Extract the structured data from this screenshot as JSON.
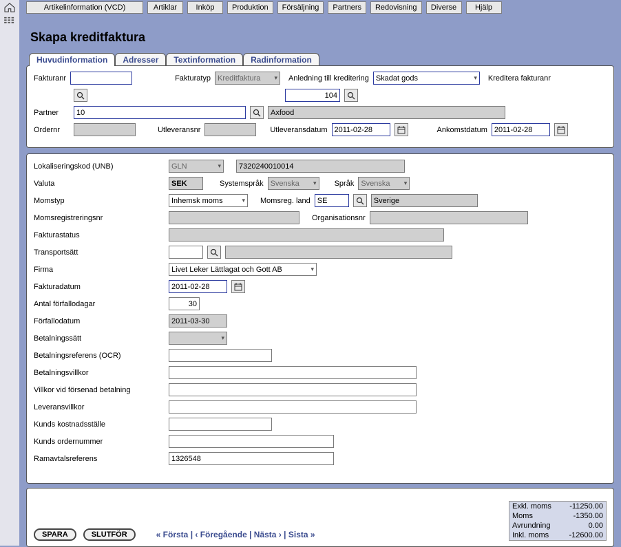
{
  "topmenu": [
    "Artikelinformation (VCD)",
    "Artiklar",
    "Inköp",
    "Produktion",
    "Försäljning",
    "Partners",
    "Redovisning",
    "Diverse",
    "Hjälp"
  ],
  "page_title": "Skapa kreditfaktura",
  "tabs": [
    "Huvudinformation",
    "Adresser",
    "Textinformation",
    "Radinformation"
  ],
  "active_tab": 0,
  "header": {
    "fakturanr_label": "Fakturanr",
    "fakturanr_value": "",
    "fakturatyp_label": "Fakturatyp",
    "fakturatyp_value": "Kreditfaktura",
    "anledning_label": "Anledning till kreditering",
    "anledning_value": "Skadat gods",
    "anledning_code": "104",
    "kreditera_label": "Kreditera fakturanr",
    "partner_label": "Partner",
    "partner_value": "10",
    "partner_name": "Axfood",
    "ordernr_label": "Ordernr",
    "ordernr_value": "",
    "utleveransnr_label": "Utleveransnr",
    "utleveransnr_value": "",
    "utleveransdatum_label": "Utleveransdatum",
    "utleveransdatum_value": "2011-02-28",
    "ankomstdatum_label": "Ankomstdatum",
    "ankomstdatum_value": "2011-02-28"
  },
  "detail": {
    "lokaliseringskod_label": "Lokaliseringskod (UNB)",
    "lokaliseringskod_type": "GLN",
    "lokaliseringskod_value": "7320240010014",
    "valuta_label": "Valuta",
    "valuta_value": "SEK",
    "systemsprak_label": "Systemspråk",
    "systemsprak_value": "Svenska",
    "sprak_label": "Språk",
    "sprak_value": "Svenska",
    "momstyp_label": "Momstyp",
    "momstyp_value": "Inhemsk moms",
    "momsregland_label": "Momsreg. land",
    "momsregland_code": "SE",
    "momsregland_name": "Sverige",
    "momsregnr_label": "Momsregistreringsnr",
    "momsregnr_value": "",
    "orgnr_label": "Organisationsnr",
    "orgnr_value": "",
    "fakturastatus_label": "Fakturastatus",
    "fakturastatus_value": "",
    "transportsatt_label": "Transportsätt",
    "transportsatt_value": "",
    "transportsatt_name": "",
    "firma_label": "Firma",
    "firma_value": "Livet Leker Lättlagat och Gott AB",
    "fakturadatum_label": "Fakturadatum",
    "fakturadatum_value": "2011-02-28",
    "antal_forfallodagar_label": "Antal förfallodagar",
    "antal_forfallodagar_value": "30",
    "forfallodatum_label": "Förfallodatum",
    "forfallodatum_value": "2011-03-30",
    "betalningssatt_label": "Betalningssätt",
    "betalningssatt_value": "",
    "betalningsreferens_label": "Betalningsreferens (OCR)",
    "betalningsreferens_value": "",
    "betalningsvillkor_label": "Betalningsvillkor",
    "betalningsvillkor_value": "",
    "villkor_forsenad_label": "Villkor vid försenad betalning",
    "villkor_forsenad_value": "",
    "leveransvillkor_label": "Leveransvillkor",
    "leveransvillkor_value": "",
    "kostnadsstalle_label": "Kunds kostnadsställe",
    "kostnadsstalle_value": "",
    "ordernummer_label": "Kunds ordernummer",
    "ordernummer_value": "",
    "ramavtal_label": "Ramavtalsreferens",
    "ramavtal_value": "1326548"
  },
  "footer": {
    "spara_label": "SPARA",
    "slutfor_label": "SLUTFÖR",
    "nav_first": "« Första",
    "nav_prev": "‹ Föregående",
    "nav_next": "Nästa ›",
    "nav_last": "Sista »",
    "totals": {
      "exkl_label": "Exkl. moms",
      "exkl_value": "-11250.00",
      "moms_label": "Moms",
      "moms_value": "-1350.00",
      "avr_label": "Avrundning",
      "avr_value": "0.00",
      "inkl_label": "Inkl. moms",
      "inkl_value": "-12600.00"
    }
  }
}
